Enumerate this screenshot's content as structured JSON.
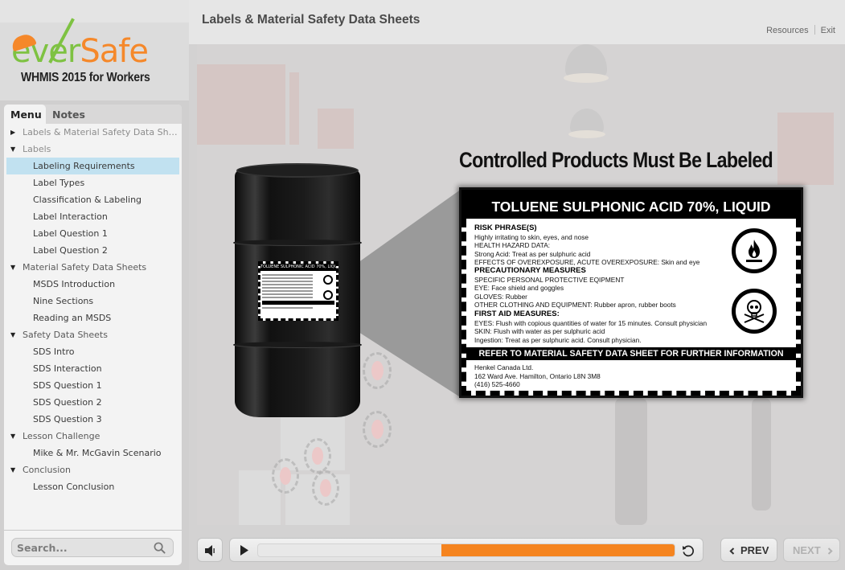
{
  "app": {
    "logo": {
      "word_part1": "ever",
      "word_part2": "Safe",
      "subtitle": "WHMIS 2015 for Workers"
    },
    "brand_colors": {
      "green": "#7ec242",
      "orange": "#f5882a",
      "selected_row": "#c1e1f0",
      "progress": "#f5841f"
    }
  },
  "sidebar": {
    "tabs": [
      {
        "label": "Menu",
        "active": true
      },
      {
        "label": "Notes",
        "active": false
      }
    ],
    "menu": [
      {
        "label": "Labels & Material Safety Data She...",
        "level": 0,
        "expanded": false,
        "icon": "triangle-right-icon"
      },
      {
        "label": "Labels",
        "level": 0,
        "expanded": true,
        "icon": "triangle-down-icon"
      },
      {
        "label": "Labeling Requirements",
        "level": 1,
        "selected": true
      },
      {
        "label": "Label Types",
        "level": 1
      },
      {
        "label": "Classification & Labeling",
        "level": 1
      },
      {
        "label": "Label Interaction",
        "level": 1
      },
      {
        "label": "Label Question 1",
        "level": 1
      },
      {
        "label": "Label Question 2",
        "level": 1
      },
      {
        "label": "Material Safety Data Sheets",
        "level": 0,
        "expanded": true,
        "icon": "triangle-down-icon"
      },
      {
        "label": "MSDS Introduction",
        "level": 1
      },
      {
        "label": "Nine Sections",
        "level": 1
      },
      {
        "label": "Reading an MSDS",
        "level": 1
      },
      {
        "label": "Safety Data Sheets",
        "level": 0,
        "expanded": true,
        "icon": "triangle-down-icon"
      },
      {
        "label": "SDS Intro",
        "level": 1
      },
      {
        "label": "SDS Interaction",
        "level": 1
      },
      {
        "label": "SDS Question 1",
        "level": 1
      },
      {
        "label": "SDS Question 2",
        "level": 1
      },
      {
        "label": "SDS Question 3",
        "level": 1
      },
      {
        "label": "Lesson Challenge",
        "level": 0,
        "expanded": true,
        "icon": "triangle-down-icon"
      },
      {
        "label": "Mike & Mr. McGavin Scenario",
        "level": 1
      },
      {
        "label": "Conclusion",
        "level": 0,
        "expanded": true,
        "icon": "triangle-down-icon"
      },
      {
        "label": "Lesson Conclusion",
        "level": 1
      }
    ],
    "search": {
      "placeholder": "Search...",
      "value": "",
      "icon": "search-icon"
    }
  },
  "header": {
    "title": "Labels & Material Safety Data Sheets",
    "links": [
      "Resources",
      "Exit"
    ]
  },
  "slide": {
    "heading": "Controlled Products Must Be Labeled",
    "label": {
      "product": "TOLUENE SULPHONIC ACID 70%, LIQUID",
      "sections": [
        {
          "heading": "RISK PHRASE(S)",
          "lines": [
            "Highly irritating to skin, eyes, and nose",
            "HEALTH HAZARD DATA:",
            "Strong Acid: Treat as per sulphuric acid",
            "EFFECTS OF OVEREXPOSURE, ACUTE OVEREXPOSURE: Skin and eye"
          ]
        },
        {
          "heading": "PRECAUTIONARY MEASURES",
          "lines": [
            "SPECIFIC PERSONAL PROTECTIVE EQIPMENT",
            "EYE: Face shield and goggles",
            "GLOVES: Rubber",
            "OTHER CLOTHING AND EQUIPMENT: Rubber apron, rubber boots"
          ]
        },
        {
          "heading": "FIRST AID MEASURES:",
          "lines": [
            "EYES: Flush with copious quantities of water for 15 minutes. Consult physician",
            "SKIN: Flush with water as per sulphuric acid",
            "Ingestion: Treat as per sulphuric acid. Consult physician."
          ]
        }
      ],
      "refer": "REFER TO MATERIAL SAFETY DATA SHEET FOR FURTHER INFORMATION",
      "supplier": [
        "Henkel Canada Ltd.",
        "162 Ward Ave. Hamilton, Ontario L8N 3M8",
        "(416) 525-4660"
      ],
      "pictograms": [
        "flammable-icon",
        "poison-skull-icon"
      ]
    }
  },
  "player": {
    "volume_icon": "speaker-icon",
    "play_icon": "play-icon",
    "replay_icon": "replay-icon",
    "progress": {
      "light_until": 0.44,
      "orange_from": 0.44,
      "orange_to": 1.0
    },
    "prev_label": "PREV",
    "next_label": "NEXT",
    "next_enabled": false
  }
}
